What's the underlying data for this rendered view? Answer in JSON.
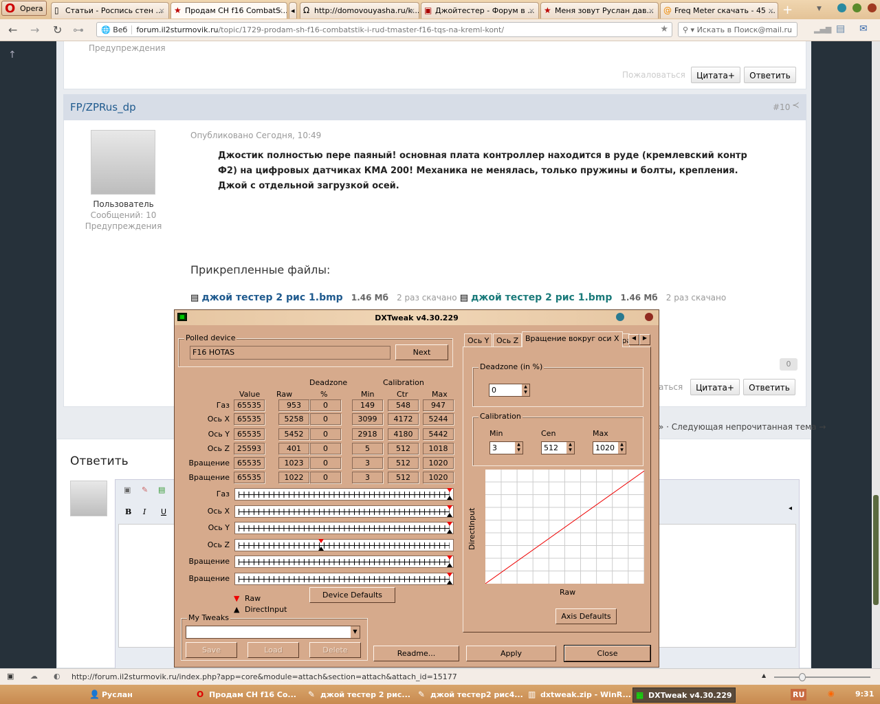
{
  "browser": {
    "menu_label": "Opera",
    "tabs": [
      {
        "title": "Статьи - Роспись стен ...",
        "icon": "page-icon"
      },
      {
        "title": "Продам CH f16 CombatS...",
        "icon": "red-star-icon",
        "active": true
      },
      {
        "title": "http://domovouyasha.ru/k...",
        "icon": "horseshoe-icon"
      },
      {
        "title": "Джойтестер - Форум в ...",
        "icon": "forum-icon"
      },
      {
        "title": "Меня зовут Руслан дав...",
        "icon": "red-star-icon"
      },
      {
        "title": "Freq Meter скачать - 45 ...",
        "icon": "mail-ru-icon"
      }
    ],
    "address_label": "Веб",
    "url_domain": "forum.il2sturmovik.ru",
    "url_path": "/topic/1729-prodam-sh-f16-combatstik-i-rud-tmaster-f16-tqs-na-kreml-kont/",
    "search_placeholder": "Искать в Поиск@mail.ru",
    "status_url": "http://forum.il2sturmovik.ru/index.php?app=core&module=attach&section=attach&attach_id=15177"
  },
  "forum": {
    "prev_warnings": "Предупреждения",
    "report": "Пожаловаться",
    "quote": "Цитата+",
    "reply": "Ответить",
    "post": {
      "author": "FP/ZPRus_dp",
      "number": "#10",
      "published": "Опубликовано Сегодня, 10:49",
      "role": "Пользователь",
      "messages": "Сообщений: 10",
      "warnings": "Предупреждения",
      "body": "Джостик полностью пере паяный! основная плата контроллер находится в руде (кремлевский контр Ф2) на цифровых датчиках КМА 200! Механика не менялась, только пружины и болты, крепления. Джой с отдельной загрузкой осей.",
      "attachments_title": "Прикрепленные файлы:",
      "attachments": [
        {
          "name": "джой тестер 2 рис 1.bmp",
          "size": "1.46 Мб",
          "downloads": "2 раз скачано"
        },
        {
          "name": "джой тестер 2 рис 1.bmp",
          "size": "1.46 Мб",
          "downloads": "2 раз скачано"
        }
      ],
      "likes": "0",
      "report_partial": "аться"
    },
    "next_topic": "» · Следующая непрочитанная тема →",
    "reply_title": "Ответить",
    "editor": {
      "bold": "B",
      "italic": "I",
      "underline": "U"
    }
  },
  "dxtweak": {
    "title": "DXTweak v4.30.229",
    "polled_device_label": "Polled device",
    "device": "F16 HOTAS",
    "next": "Next",
    "headers": {
      "value": "Value",
      "raw": "Raw",
      "deadzone": "Deadzone",
      "pct": "%",
      "calibration": "Calibration",
      "min": "Min",
      "ctr": "Ctr",
      "max": "Max"
    },
    "rows": [
      {
        "axis": "Газ",
        "value": "65535",
        "raw": "953",
        "dz": "0",
        "min": "149",
        "ctr": "548",
        "max": "947",
        "raw_pos": 1.0,
        "di_pos": 1.0
      },
      {
        "axis": "Ось X",
        "value": "65535",
        "raw": "5258",
        "dz": "0",
        "min": "3099",
        "ctr": "4172",
        "max": "5244",
        "raw_pos": 1.0,
        "di_pos": 1.0
      },
      {
        "axis": "Ось Y",
        "value": "65535",
        "raw": "5452",
        "dz": "0",
        "min": "2918",
        "ctr": "4180",
        "max": "5442",
        "raw_pos": 1.0,
        "di_pos": 1.0
      },
      {
        "axis": "Ось Z",
        "value": "25593",
        "raw": "401",
        "dz": "0",
        "min": "5",
        "ctr": "512",
        "max": "1018",
        "raw_pos": 0.39,
        "di_pos": 0.39
      },
      {
        "axis": "Вращение",
        "value": "65535",
        "raw": "1023",
        "dz": "0",
        "min": "3",
        "ctr": "512",
        "max": "1020",
        "raw_pos": 1.0,
        "di_pos": 1.0
      },
      {
        "axis": "Вращение",
        "value": "65535",
        "raw": "1022",
        "dz": "0",
        "min": "3",
        "ctr": "512",
        "max": "1020",
        "raw_pos": 1.0,
        "di_pos": 1.0
      }
    ],
    "legend_raw": "Raw",
    "legend_di": "DirectInput",
    "device_defaults": "Device Defaults",
    "my_tweaks": "My Tweaks",
    "save": "Save",
    "load": "Load",
    "delete": "Delete",
    "readme": "Readme...",
    "apply": "Apply",
    "close": "Close",
    "tabs": [
      "Ось Y",
      "Ось Z",
      "Вращение вокруг оси X",
      "Вра"
    ],
    "deadzone_label": "Deadzone (in %)",
    "deadzone_value": "0",
    "calibration_label": "Calibration",
    "cal_min_label": "Min",
    "cal_min": "3",
    "cal_cen_label": "Cen",
    "cal_cen": "512",
    "cal_max_label": "Max",
    "cal_max": "1020",
    "graph_ylabel": "DirectInput",
    "graph_xlabel": "Raw",
    "axis_defaults": "Axis Defaults"
  },
  "taskbar": {
    "items": [
      "Руслан",
      "Продам CH f16 Co...",
      "джой тестер 2 рис...",
      "джой тестер2 рис4...",
      "dxtweak.zip - WinR...",
      "DXTweak v4.30.229"
    ],
    "lang": "RU",
    "time": "9:31"
  }
}
